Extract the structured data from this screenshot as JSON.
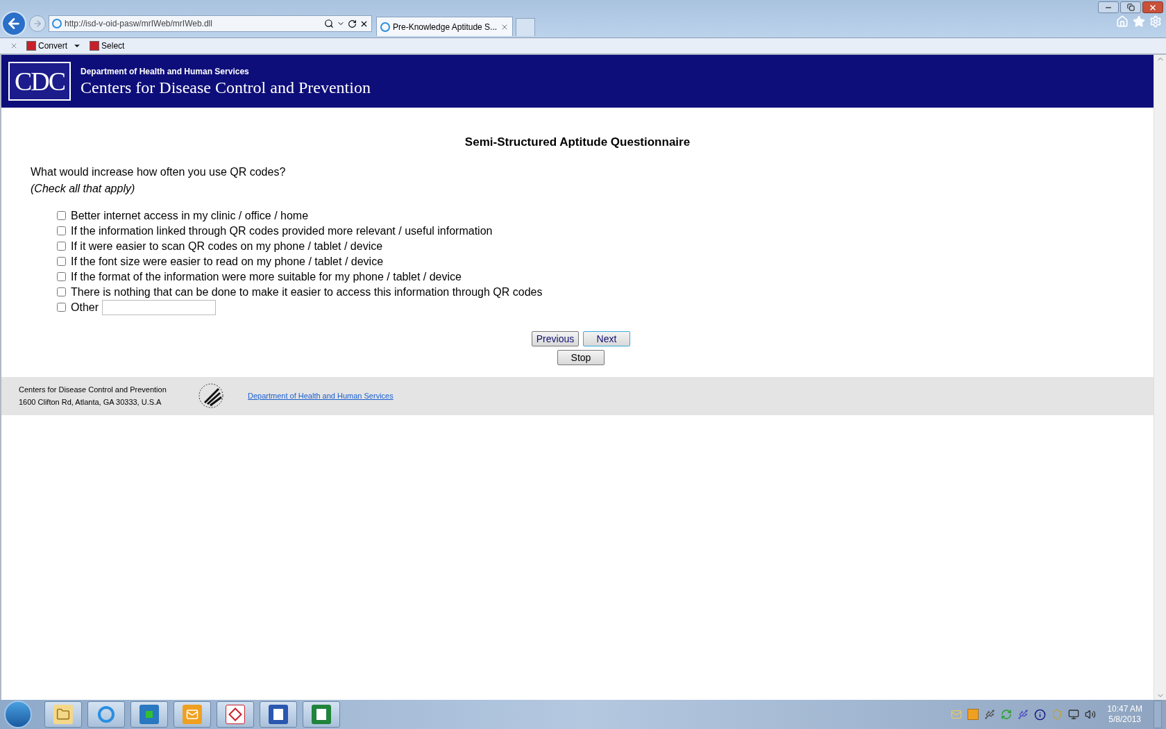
{
  "browser": {
    "address": "http://isd-v-oid-pasw/mrIWeb/mrIWeb.dll",
    "tabs": [
      {
        "label": "Pre-Knowledge Aptitude S...",
        "selected": true
      }
    ],
    "toolbar": [
      "Convert",
      "Select"
    ]
  },
  "header": {
    "logo": "CDC",
    "department": "Department of Health and Human Services",
    "agency": "Centers for Disease Control and Prevention"
  },
  "survey": {
    "title": "Semi-Structured Aptitude Questionnaire",
    "question": "What would increase how often you use QR codes?",
    "instruction": "(Check all that apply)",
    "options": [
      {
        "label": "Better internet access in my clinic / office / home",
        "checked": false,
        "kind": "plain"
      },
      {
        "label": "If the information linked through QR codes provided more relevant / useful information",
        "checked": false,
        "kind": "plain"
      },
      {
        "label": "If it were easier to scan QR codes on my phone / tablet / device",
        "checked": false,
        "kind": "plain"
      },
      {
        "label": "If the font size were easier to read on my phone / tablet / device",
        "checked": false,
        "kind": "plain"
      },
      {
        "label": "If the format of the information were more suitable for my phone / tablet / device",
        "checked": false,
        "kind": "plain"
      },
      {
        "label": "There is nothing that can be done to make it easier to access this information through QR codes",
        "checked": false,
        "kind": "plain"
      },
      {
        "label": "Other",
        "checked": false,
        "kind": "other"
      }
    ],
    "buttons": [
      "Previous",
      "Next"
    ],
    "stop_button": "Stop"
  },
  "footer": {
    "lines": [
      "Centers for Disease Control and Prevention",
      "1600 Clifton Rd, Atlanta, GA 30333, U.S.A"
    ],
    "link": "Department of Health and Human Services"
  },
  "taskbar": {
    "time": "10:47 AM",
    "date": "5/8/2013"
  }
}
